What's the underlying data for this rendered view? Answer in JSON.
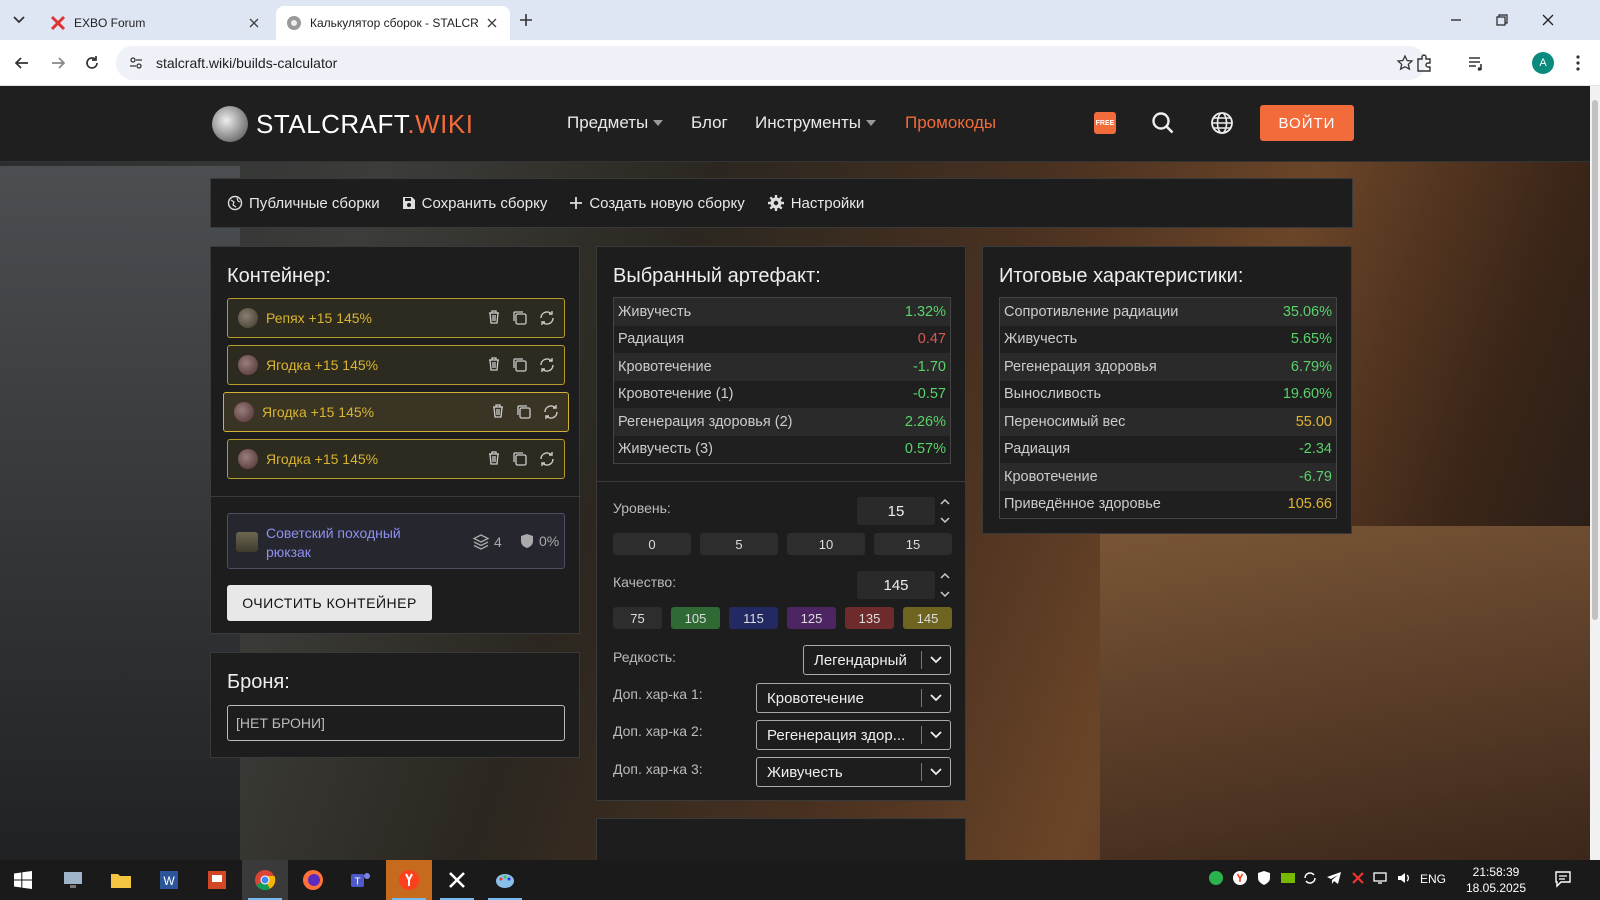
{
  "browser": {
    "tabs": [
      {
        "title": "EXBO Forum"
      },
      {
        "title": "Калькулятор сборок - STALCRA"
      }
    ],
    "url": "stalcraft.wiki/builds-calculator",
    "profile_initial": "A"
  },
  "site": {
    "logo_main": "STALCRAFT",
    "logo_accent": ".WIKI",
    "nav": [
      "Предметы",
      "Блог",
      "Инструменты",
      "Промокоды"
    ],
    "free_badge": "FREE",
    "login": "ВОЙТИ",
    "accent_color": "#f26b3a"
  },
  "toolbar": {
    "items": [
      "Публичные сборки",
      "Сохранить сборку",
      "Создать новую сборку",
      "Настройки"
    ]
  },
  "container": {
    "title": "Контейнер:",
    "artifacts": [
      {
        "name": "Репях +15 145%"
      },
      {
        "name": "Ягодка +15 145%"
      },
      {
        "name": "Ягодка +15 145%"
      },
      {
        "name": "Ягодка +15 145%"
      }
    ],
    "backpack": {
      "name": "Советский походный рюкзак",
      "slots": "4",
      "protection": "0%"
    },
    "clear_button": "ОЧИСТИТЬ КОНТЕЙНЕР"
  },
  "armor": {
    "title": "Броня:",
    "value": "[НЕТ БРОНИ]"
  },
  "artifact": {
    "title": "Выбранный артефакт:",
    "stats": [
      {
        "name": "Живучесть",
        "value": "1.32%",
        "color": "green"
      },
      {
        "name": "Радиация",
        "value": "0.47",
        "color": "red"
      },
      {
        "name": "Кровотечение",
        "value": "-1.70",
        "color": "green"
      },
      {
        "name": "Кровотечение (1)",
        "value": "-0.57",
        "color": "green"
      },
      {
        "name": "Регенерация здоровья (2)",
        "value": "2.26%",
        "color": "green"
      },
      {
        "name": "Живучесть (3)",
        "value": "0.57%",
        "color": "green"
      }
    ],
    "level_label": "Уровень:",
    "level_value": "15",
    "level_presets": [
      "0",
      "5",
      "10",
      "15"
    ],
    "quality_label": "Качество:",
    "quality_value": "145",
    "quality_presets": [
      {
        "label": "75",
        "color": "#2d2d2d"
      },
      {
        "label": "105",
        "color": "#2f6a35"
      },
      {
        "label": "115",
        "color": "#232a63"
      },
      {
        "label": "125",
        "color": "#4e2563"
      },
      {
        "label": "135",
        "color": "#6e2b2b"
      },
      {
        "label": "145",
        "color": "#6e6420"
      }
    ],
    "rarity_label": "Редкость:",
    "rarity_value": "Легендарный",
    "extra1_label": "Доп. хар-ка 1:",
    "extra1_value": "Кровотечение",
    "extra2_label": "Доп. хар-ка 2:",
    "extra2_value": "Регенерация здор...",
    "extra3_label": "Доп. хар-ка 3:",
    "extra3_value": "Живучесть"
  },
  "result": {
    "title": "Итоговые характеристики:",
    "stats": [
      {
        "name": "Сопротивление радиации",
        "value": "35.06%",
        "color": "green"
      },
      {
        "name": "Живучесть",
        "value": "5.65%",
        "color": "green"
      },
      {
        "name": "Регенерация здоровья",
        "value": "6.79%",
        "color": "green"
      },
      {
        "name": "Выносливость",
        "value": "19.60%",
        "color": "green"
      },
      {
        "name": "Переносимый вес",
        "value": "55.00",
        "color": "gold"
      },
      {
        "name": "Радиация",
        "value": "-2.34",
        "color": "green"
      },
      {
        "name": "Кровотечение",
        "value": "-6.79",
        "color": "green"
      },
      {
        "name": "Приведённое здоровье",
        "value": "105.66",
        "color": "gold"
      }
    ]
  },
  "taskbar": {
    "lang": "ENG",
    "time": "21:58:39",
    "date": "18.05.2025"
  }
}
